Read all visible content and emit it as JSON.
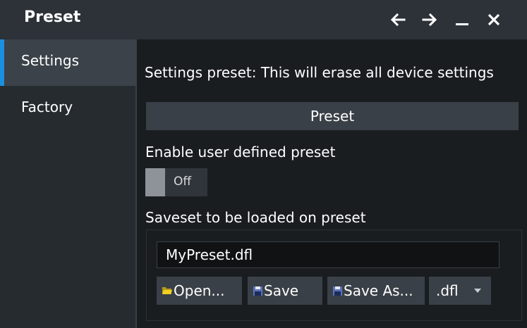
{
  "window": {
    "title": "Preset",
    "back_icon": "arrow-left-icon",
    "forward_icon": "arrow-right-icon",
    "minimize_icon": "minimize-icon",
    "close_icon": "close-icon"
  },
  "sidebar": {
    "items": [
      {
        "label": "Settings",
        "active": true
      },
      {
        "label": "Factory",
        "active": false
      }
    ]
  },
  "settings": {
    "description": "Settings preset: This will erase all device settings",
    "preset_button": "Preset",
    "user_preset_label": "Enable user defined preset",
    "toggle_state": "Off",
    "saveset_label": "Saveset to be loaded on preset",
    "saveset_file": "MyPreset.dfl",
    "open_button": "Open...",
    "save_button": "Save",
    "save_as_button": "Save As...",
    "extension": ".dfl"
  },
  "colors": {
    "accent": "#1d8fe0",
    "titlebar": "#2c3238",
    "sidebar": "#262b30",
    "content": "#1a1d20",
    "button": "#3a4047"
  }
}
